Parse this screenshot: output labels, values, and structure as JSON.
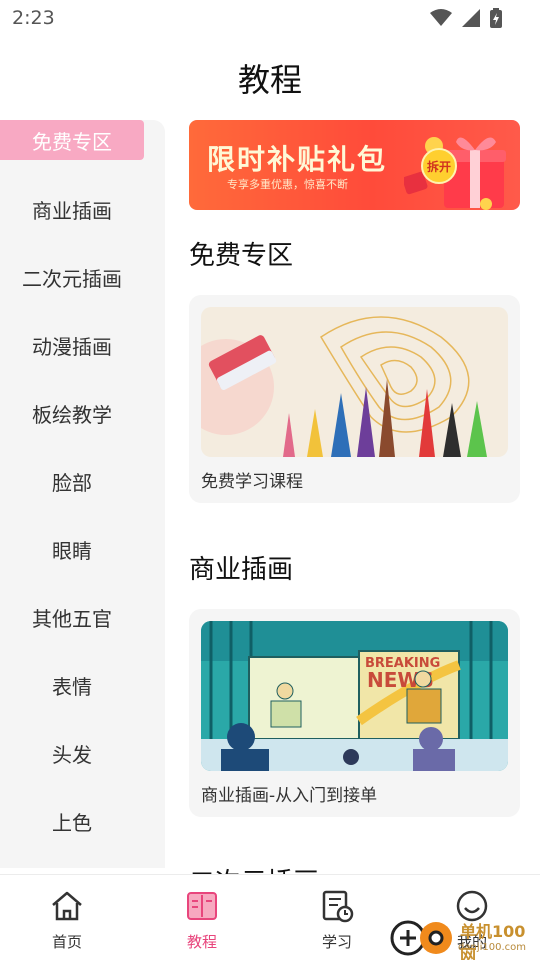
{
  "status_bar": {
    "time": "2:23"
  },
  "page": {
    "title": "教程"
  },
  "sidebar": {
    "items": [
      {
        "label": "免费专区",
        "active": true
      },
      {
        "label": "商业插画"
      },
      {
        "label": "二次元插画"
      },
      {
        "label": "动漫插画"
      },
      {
        "label": "板绘教学"
      },
      {
        "label": "脸部"
      },
      {
        "label": "眼睛"
      },
      {
        "label": "其他五官"
      },
      {
        "label": "表情"
      },
      {
        "label": "头发"
      },
      {
        "label": "上色"
      }
    ]
  },
  "banner": {
    "title": "限时补贴礼包",
    "subtitle": "专享多重优惠，惊喜不断",
    "open_label": "拆开"
  },
  "sections": [
    {
      "title": "免费专区",
      "card_caption": "免费学习课程"
    },
    {
      "title": "商业插画",
      "card_caption": "商业插画-从入门到接单"
    },
    {
      "title": "二次元插画"
    }
  ],
  "artwork": {
    "news_sign_1": "BREAKING",
    "news_sign_2": "NEWS"
  },
  "tabbar": {
    "tabs": [
      {
        "label": "首页",
        "icon": "home-icon"
      },
      {
        "label": "教程",
        "icon": "book-icon",
        "active": true
      },
      {
        "label": "学习",
        "icon": "study-icon"
      },
      {
        "label": "我的",
        "icon": "profile-icon"
      }
    ]
  },
  "watermark": {
    "line1": "单机100网",
    "line2": "danji100.com"
  },
  "colors": {
    "accent": "#e8457c",
    "active_side": "#f8a9c3",
    "panel": "#f5f5f5"
  }
}
